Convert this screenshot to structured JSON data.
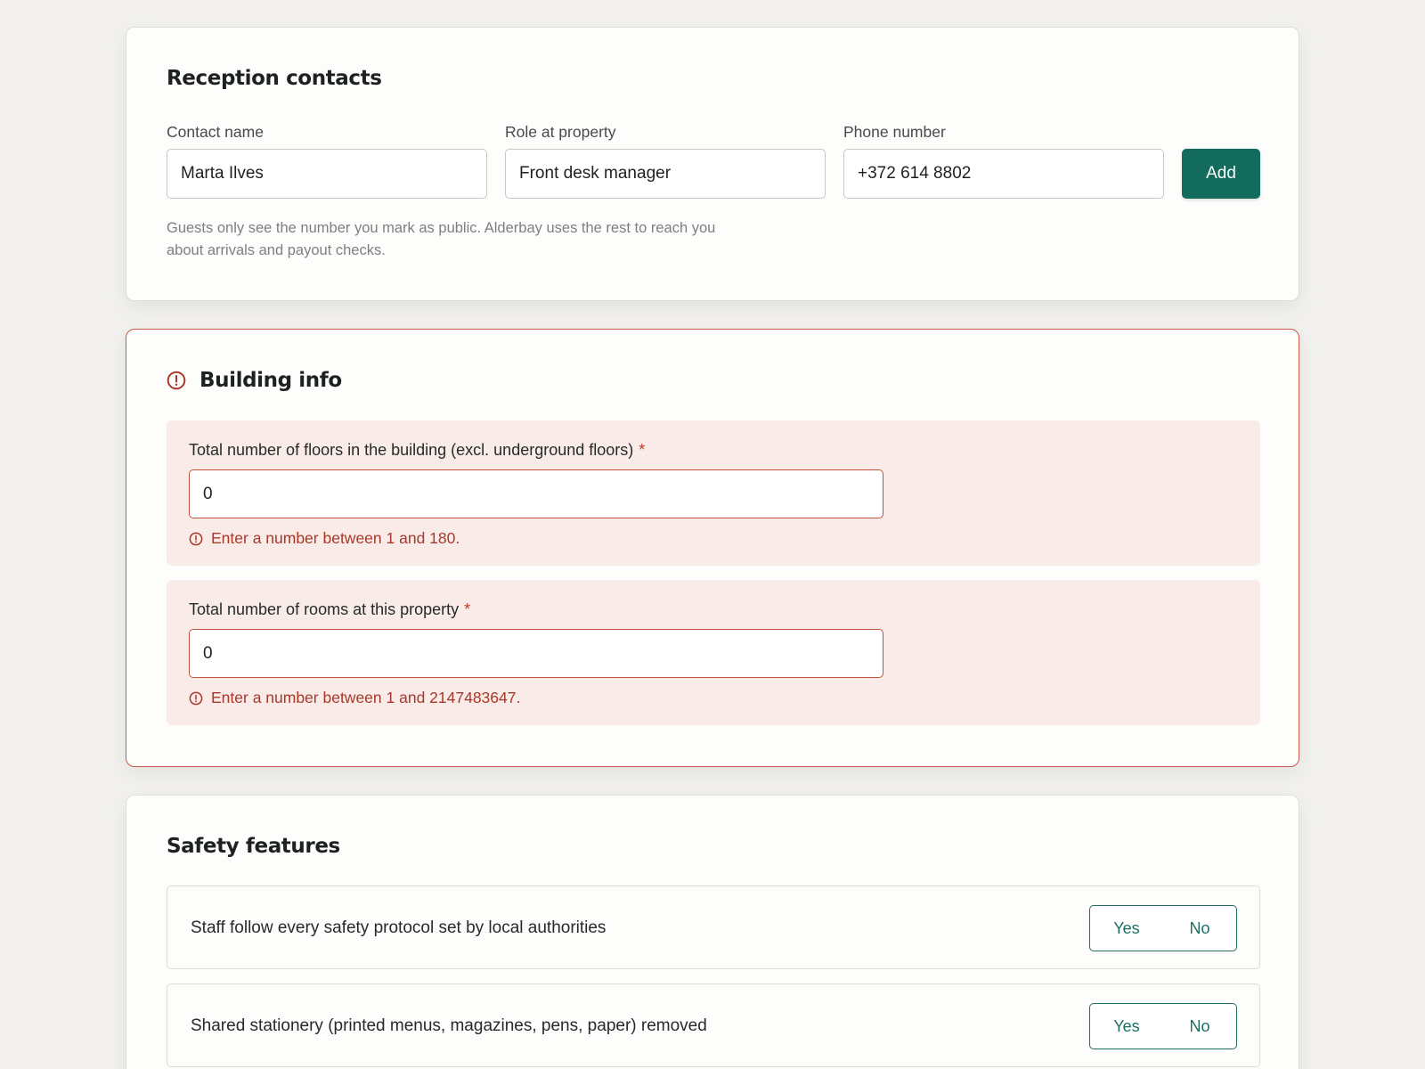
{
  "reception_contacts": {
    "title": "Reception contacts",
    "fields": {
      "contact_name": {
        "label": "Contact name",
        "value": "Marta Ilves"
      },
      "role": {
        "label": "Role at property",
        "value": "Front desk manager"
      },
      "phone": {
        "label": "Phone number",
        "value": "+372 614 8802"
      }
    },
    "add_label": "Add",
    "helper_line_1": "Guests only see the number you mark as public. Alderbay uses the rest to reach you",
    "helper_line_2": "about arrivals and payout checks."
  },
  "building_info": {
    "title": "Building info",
    "status_icon": "alert-circle-icon",
    "floors": {
      "label": "Total number of floors in the building (excl. underground floors)",
      "required_mark": "*",
      "value": "0",
      "error": "Enter a number between 1 and 180."
    },
    "rooms": {
      "label": "Total number of rooms at this property",
      "required_mark": "*",
      "value": "0",
      "error": "Enter a number between 1 and 2147483647."
    }
  },
  "safety_features": {
    "title": "Safety features",
    "items": [
      {
        "label": "Staff follow every safety protocol set by local authorities",
        "yes": "Yes",
        "no": "No"
      },
      {
        "label": "Shared stationery (printed menus, magazines, pens, paper) removed",
        "yes": "Yes",
        "no": "No"
      }
    ]
  },
  "colors": {
    "background": "#f1f0ed",
    "primary": "#136b5e",
    "error": "#a8382a",
    "error_border": "#cc5a48",
    "error_panel": "#f9ebe8"
  }
}
